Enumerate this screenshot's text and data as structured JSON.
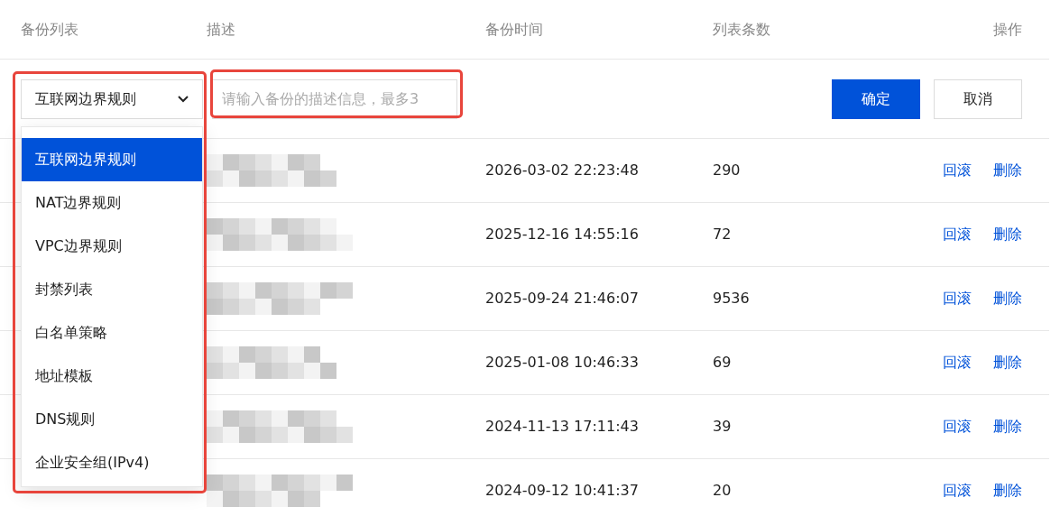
{
  "columns": [
    "备份列表",
    "描述",
    "备份时间",
    "列表条数",
    "操作"
  ],
  "edit_row": {
    "select": {
      "value": "互联网边界规则",
      "expanded": true
    },
    "description": {
      "placeholder": "请输入备份的描述信息，最多3"
    },
    "buttons": [
      {
        "label": "确定",
        "kind": "primary"
      },
      {
        "label": "取消",
        "kind": "secondary"
      }
    ]
  },
  "dropdown": [
    {
      "label": "互联网边界规则",
      "selected": true
    },
    {
      "label": "NAT边界规则",
      "selected": false
    },
    {
      "label": "VPC边界规则",
      "selected": false
    },
    {
      "label": "封禁列表",
      "selected": false
    },
    {
      "label": "白名单策略",
      "selected": false
    },
    {
      "label": "地址模板",
      "selected": false
    },
    {
      "label": "DNS规则",
      "selected": false
    },
    {
      "label": "企业安全组(IPv4)",
      "selected": false
    }
  ],
  "rows": [
    {
      "time": "2026-03-02 22:23:48",
      "count": "290",
      "actions": [
        "回滚",
        "删除"
      ]
    },
    {
      "time": "2025-12-16 14:55:16",
      "count": "72",
      "actions": [
        "回滚",
        "删除"
      ]
    },
    {
      "time": "2025-09-24 21:46:07",
      "count": "9536",
      "actions": [
        "回滚",
        "删除"
      ]
    },
    {
      "time": "2025-01-08 10:46:33",
      "count": "69",
      "actions": [
        "回滚",
        "删除"
      ]
    },
    {
      "time": "2024-11-13 17:11:43",
      "count": "39",
      "actions": [
        "回滚",
        "删除"
      ]
    },
    {
      "time": "2024-09-12 10:41:37",
      "count": "20",
      "actions": [
        "回滚",
        "删除"
      ]
    }
  ]
}
